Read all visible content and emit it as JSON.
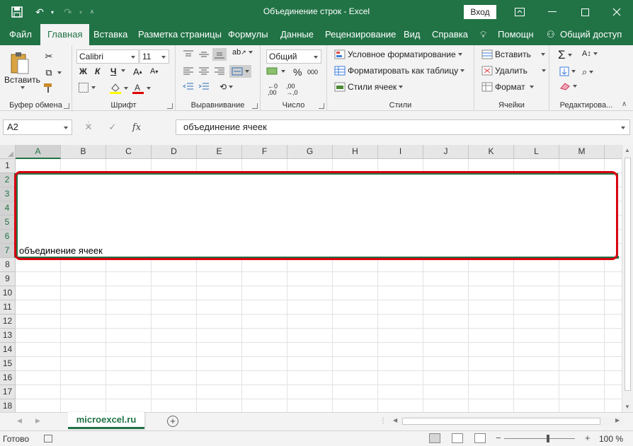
{
  "window": {
    "title": "Объединение строк  -  Excel",
    "login": "Вход"
  },
  "tabs": [
    "Файл",
    "Главная",
    "Вставка",
    "Разметка страницы",
    "Формулы",
    "Данные",
    "Рецензирование",
    "Вид",
    "Справка"
  ],
  "help": "Помощн",
  "share": "Общий доступ",
  "ribbon": {
    "clipboard": {
      "paste": "Вставить",
      "label": "Буфер обмена"
    },
    "font": {
      "name": "Calibri",
      "size": "11",
      "bold": "Ж",
      "italic": "К",
      "underline": "Ч",
      "label": "Шрифт"
    },
    "alignment": {
      "label": "Выравнивание"
    },
    "number": {
      "format": "Общий",
      "percent": "%",
      "thousands": "000",
      "label": "Число"
    },
    "styles": {
      "conditional": "Условное форматирование",
      "table": "Форматировать как таблицу",
      "cell_styles": "Стили ячеек",
      "label": "Стили"
    },
    "cells": {
      "insert": "Вставить",
      "delete": "Удалить",
      "format": "Формат",
      "label": "Ячейки"
    },
    "editing": {
      "label": "Редактирова..."
    }
  },
  "formula_bar": {
    "name_box": "A2",
    "fx": "fx",
    "value": "объединение ячеек"
  },
  "grid": {
    "columns": [
      "A",
      "B",
      "C",
      "D",
      "E",
      "F",
      "G",
      "H",
      "I",
      "J",
      "K",
      "L",
      "M"
    ],
    "rows": [
      "1",
      "2",
      "3",
      "4",
      "5",
      "6",
      "7",
      "8",
      "9",
      "10",
      "11",
      "12",
      "13",
      "14",
      "15",
      "16",
      "17",
      "18"
    ],
    "merged_cell_text": "объединение ячеек",
    "selected_cell": "A2",
    "highlight_color": "#d9000f"
  },
  "sheets": [
    {
      "name": "microexcel.ru",
      "active": true
    }
  ],
  "status": {
    "ready": "Готово",
    "zoom": "100 %",
    "zoom_minus": "−",
    "zoom_plus": "+"
  },
  "colors": {
    "accent": "#217346",
    "ribbon_bg": "#f3f3f3"
  }
}
